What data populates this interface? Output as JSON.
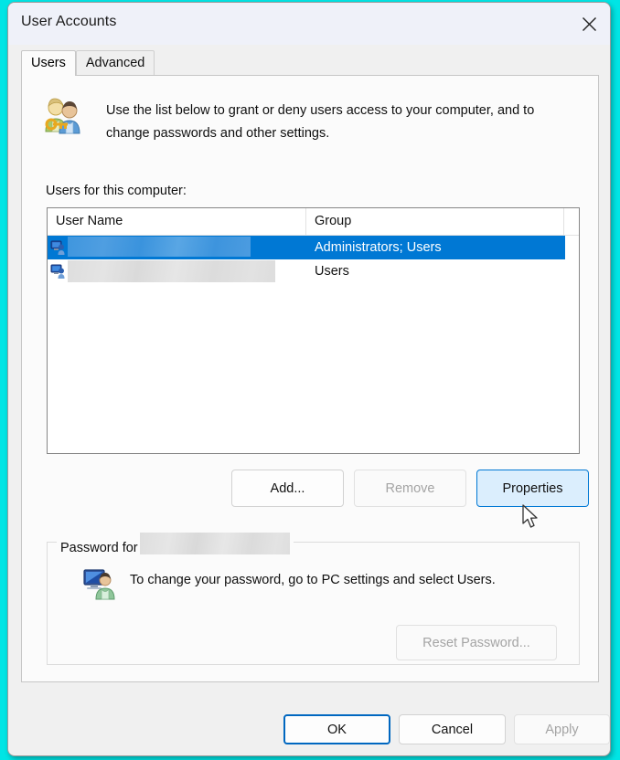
{
  "window": {
    "title": "User Accounts",
    "close_icon": "close-icon"
  },
  "tabs": [
    {
      "label": "Users",
      "active": true
    },
    {
      "label": "Advanced",
      "active": false
    }
  ],
  "panel": {
    "intro_icon": "users-key-icon",
    "intro_text": "Use the list below to grant or deny users access to your computer, and to change passwords and other settings.",
    "list_label": "Users for this computer:"
  },
  "list": {
    "columns": [
      "User Name",
      "Group"
    ],
    "rows": [
      {
        "user_name": "",
        "user_name_redacted": true,
        "group": "Administrators; Users",
        "selected": true,
        "icon": "user-account-icon"
      },
      {
        "user_name": "",
        "user_name_redacted": true,
        "group": "Users",
        "selected": false,
        "icon": "user-account-icon"
      }
    ]
  },
  "list_buttons": {
    "add": "Add...",
    "remove": "Remove",
    "properties": "Properties"
  },
  "password_group": {
    "legend_prefix": "Password for",
    "legend_value_redacted": true,
    "icon": "user-monitor-icon",
    "message": "To change your password, go to PC settings and select Users.",
    "reset_button": "Reset Password..."
  },
  "footer": {
    "ok": "OK",
    "cancel": "Cancel",
    "apply": "Apply"
  },
  "cursor": {
    "icon": "arrow-cursor"
  },
  "colors": {
    "accent": "#0078d4",
    "default_button_border": "#0067c0",
    "hover_button_bg": "#dbeefd",
    "titlebar_bg": "#eff1f9",
    "window_bg": "#f0f0f0",
    "panel_bg": "#fbfbfb",
    "disabled_text": "#a4a4a4"
  }
}
